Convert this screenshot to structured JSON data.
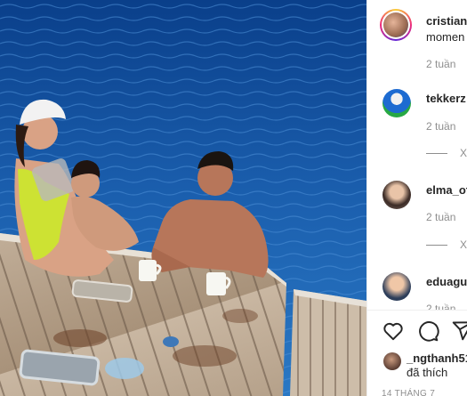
{
  "post": {
    "author_username": "cristiano",
    "caption_partial": "momen",
    "posted_ago": "2 tuần"
  },
  "comments": [
    {
      "username": "tekkerz",
      "time": "2 tuần",
      "reply_x": "X"
    },
    {
      "username": "elma_of",
      "time": "2 tuần",
      "reply_x": "X"
    },
    {
      "username": "eduagu",
      "time": "2 tuần"
    }
  ],
  "actions": {
    "like_icon": "heart-icon",
    "comment_icon": "comment-icon",
    "share_icon": "send-icon"
  },
  "likes": {
    "liker_username": "_ngthanh51",
    "liked_text": "đã thích"
  },
  "post_date": "14 THÁNG 7"
}
